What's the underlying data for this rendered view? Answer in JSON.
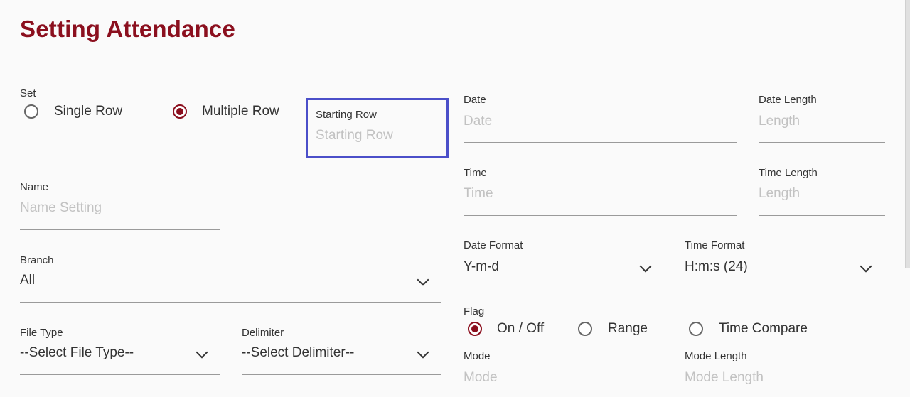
{
  "page": {
    "title": "Setting Attendance"
  },
  "set": {
    "label": "Set",
    "options": [
      {
        "label": "Single Row",
        "checked": false
      },
      {
        "label": "Multiple Row",
        "checked": true
      }
    ]
  },
  "starting_row": {
    "label": "Starting Row",
    "placeholder": "Starting Row"
  },
  "name": {
    "label": "Name",
    "placeholder": "Name Setting"
  },
  "branch": {
    "label": "Branch",
    "value": "All"
  },
  "file_type": {
    "label": "File Type",
    "value": "--Select File Type--"
  },
  "delimiter": {
    "label": "Delimiter",
    "value": "--Select Delimiter--"
  },
  "date": {
    "label": "Date",
    "placeholder": "Date"
  },
  "date_length": {
    "label": "Date Length",
    "placeholder": "Length"
  },
  "time": {
    "label": "Time",
    "placeholder": "Time"
  },
  "time_length": {
    "label": "Time Length",
    "placeholder": "Length"
  },
  "date_format": {
    "label": "Date Format",
    "value": "Y-m-d"
  },
  "time_format": {
    "label": "Time Format",
    "value": "H:m:s (24)"
  },
  "flag": {
    "label": "Flag",
    "options": [
      {
        "label": "On / Off",
        "checked": true
      },
      {
        "label": "Range",
        "checked": false
      },
      {
        "label": "Time Compare",
        "checked": false
      }
    ]
  },
  "mode": {
    "label": "Mode",
    "placeholder": "Mode"
  },
  "mode_length": {
    "label": "Mode Length",
    "placeholder": "Mode Length"
  },
  "colors": {
    "accent": "#8b0f1e",
    "focus": "#4b4fc9"
  }
}
